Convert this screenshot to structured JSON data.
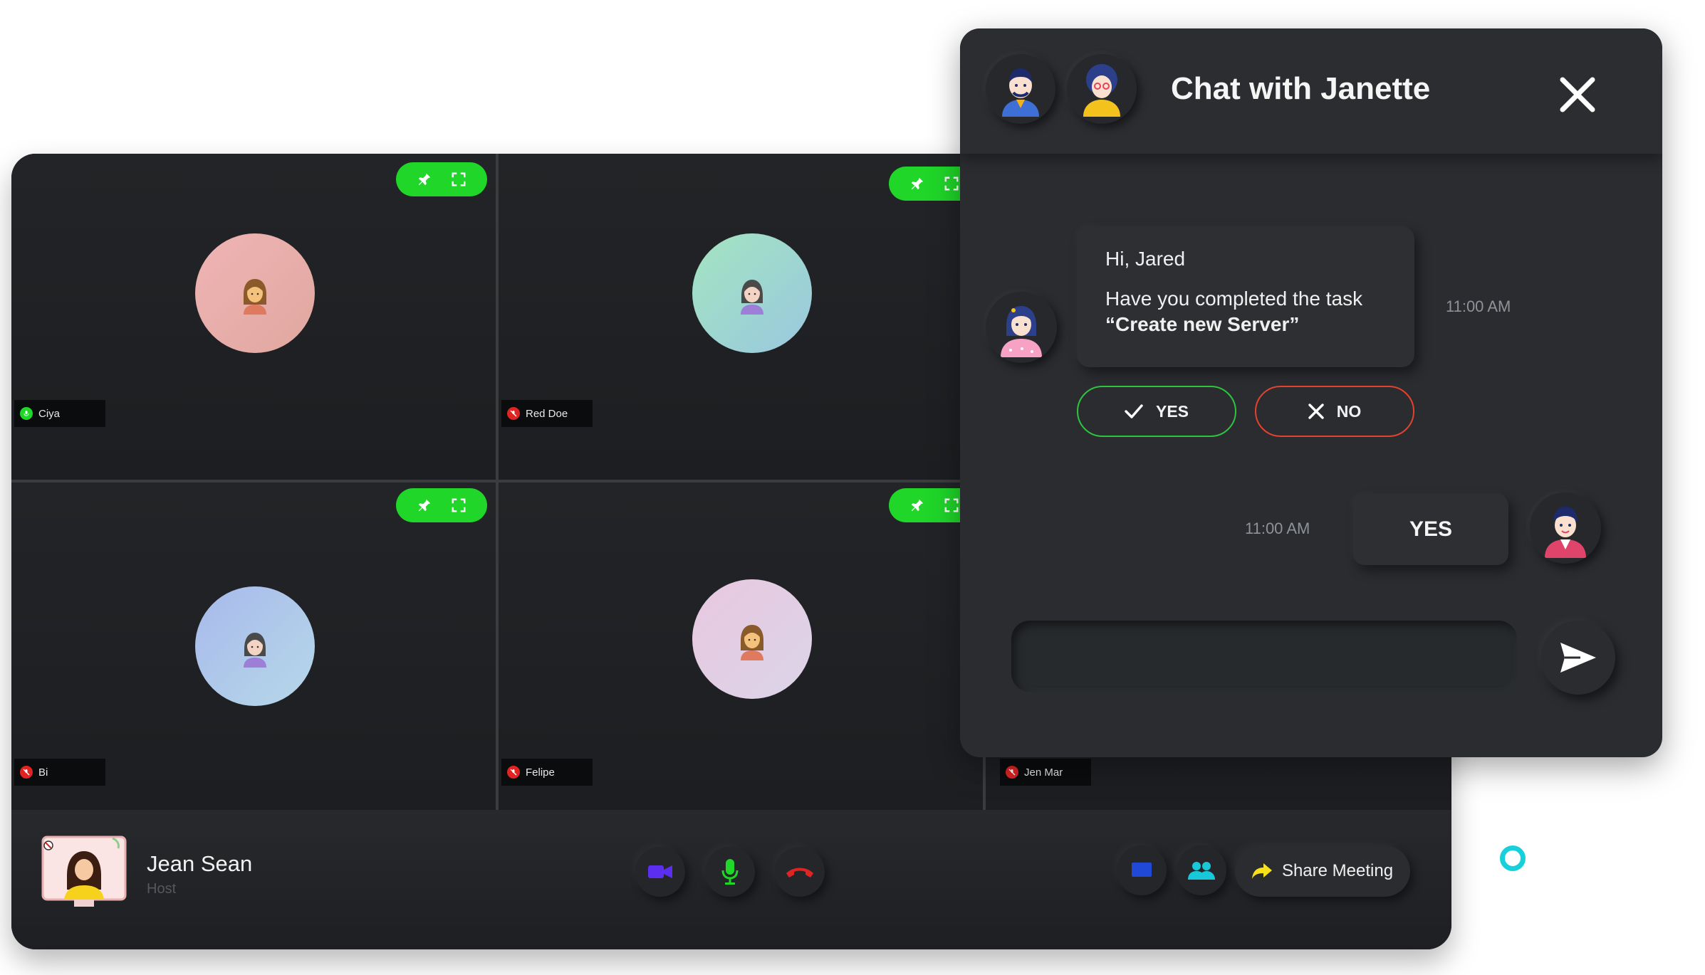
{
  "participants": [
    {
      "name": "Ciya",
      "mic": "on",
      "status_color": "#1fd629"
    },
    {
      "name": "Red Doe",
      "mic": "muted",
      "status_color": "#e02424"
    },
    {
      "name": "Bi",
      "mic": "muted",
      "status_color": "#e02424"
    },
    {
      "name": "Felipe",
      "mic": "muted",
      "status_color": "#e02424"
    },
    {
      "name": "Jen Mar",
      "mic": "muted",
      "status_color": "#e02424"
    }
  ],
  "tile_controls": {
    "pin_icon": "pin-icon",
    "fullscreen_icon": "fullscreen-icon",
    "color": "#1fd629"
  },
  "host": {
    "name": "Jean Sean",
    "role": "Host"
  },
  "controls": {
    "video_icon": "video-camera-icon",
    "mic_icon": "microphone-icon",
    "end_call_icon": "end-call-icon",
    "chat_icon": "chat-icon",
    "participants_icon": "participants-icon",
    "share_label": "Share Meeting",
    "share_icon": "share-arrow-icon"
  },
  "chat": {
    "title": "Chat with Janette",
    "close_icon": "close-icon",
    "incoming": {
      "greeting": "Hi, Jared",
      "question": "Have you completed the task",
      "task": "“Create new Server”",
      "time": "11:00 AM"
    },
    "answers": {
      "yes": "YES",
      "no": "NO"
    },
    "outgoing": {
      "text": "YES",
      "time": "11:00 AM"
    },
    "input": {
      "value": "",
      "placeholder": ""
    },
    "send_icon": "send-icon"
  },
  "colors": {
    "accent_green": "#1fd629",
    "danger_red": "#e02424",
    "video_purple": "#5b2ef0",
    "chat_blue": "#1f49d6",
    "participants_cyan": "#19c8d8",
    "share_yellow": "#f7e11c"
  }
}
